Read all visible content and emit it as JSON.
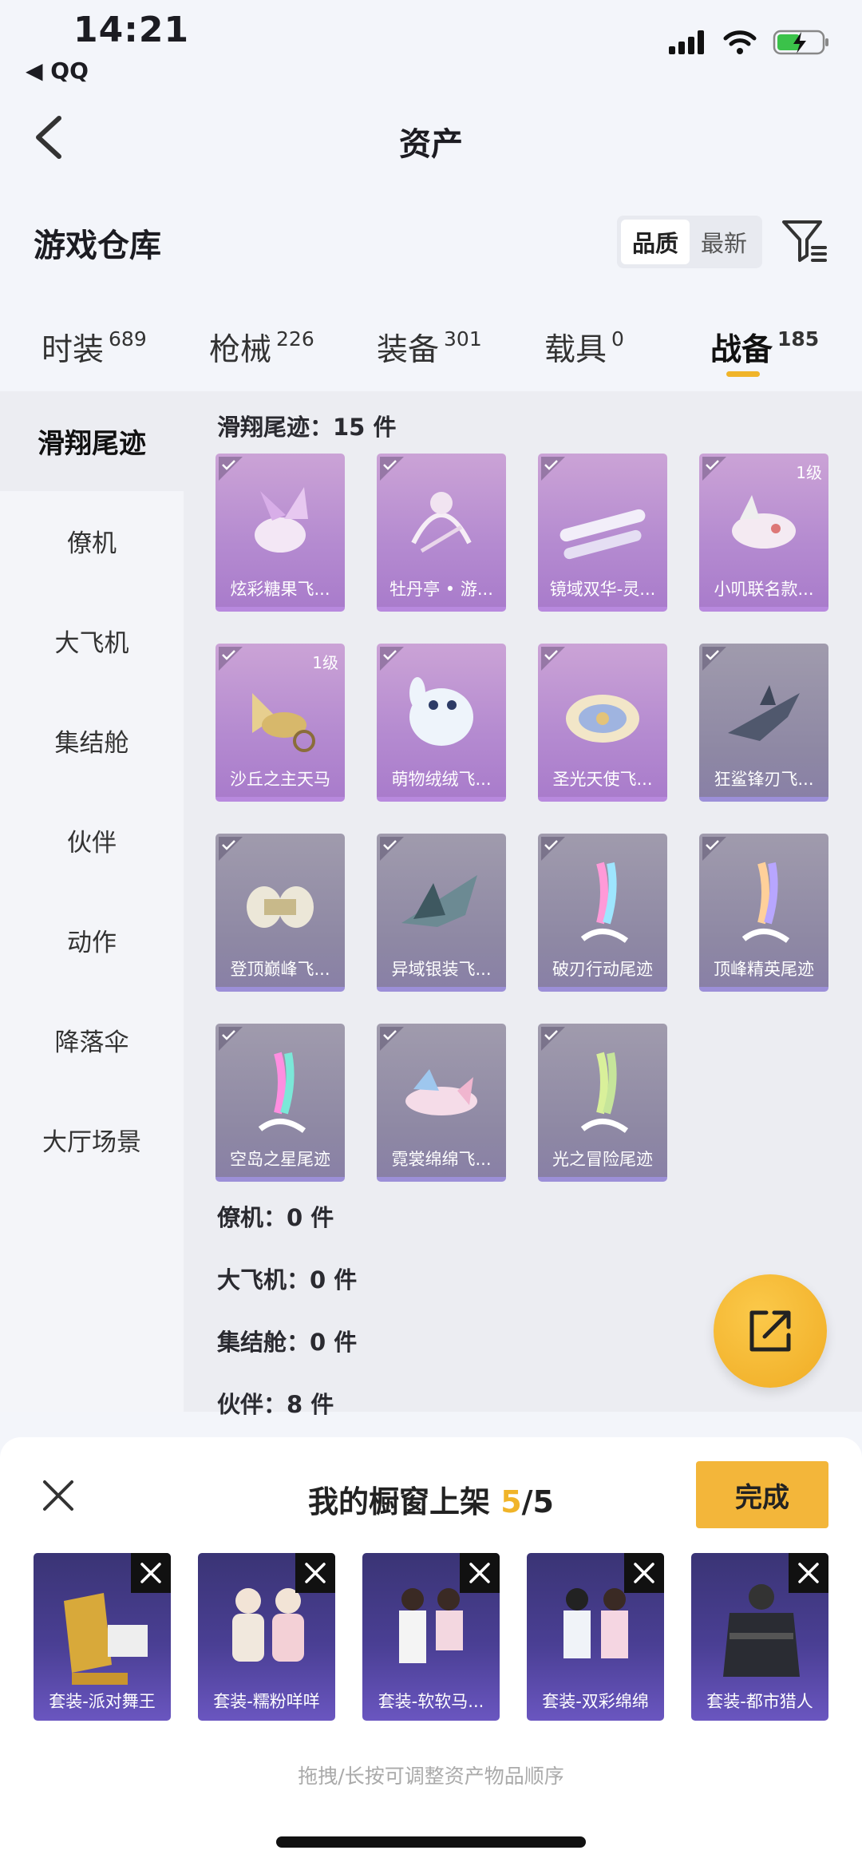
{
  "status_bar": {
    "time": "14:21",
    "back_app": "◀ QQ"
  },
  "nav": {
    "title": "资产"
  },
  "warehouse": {
    "title": "游戏仓库",
    "sort_options": [
      "品质",
      "最新"
    ],
    "active_sort": "品质"
  },
  "tabs": [
    {
      "label": "时装",
      "count": "689"
    },
    {
      "label": "枪械",
      "count": "226"
    },
    {
      "label": "装备",
      "count": "301"
    },
    {
      "label": "载具",
      "count": "0"
    },
    {
      "label": "战备",
      "count": "185"
    }
  ],
  "active_tab": "战备",
  "sidebar": [
    {
      "label": "滑翔尾迹"
    },
    {
      "label": "僚机"
    },
    {
      "label": "大飞机"
    },
    {
      "label": "集结舱"
    },
    {
      "label": "伙伴"
    },
    {
      "label": "动作"
    },
    {
      "label": "降落伞"
    },
    {
      "label": "大厅场景"
    }
  ],
  "sections": {
    "glide": "滑翔尾迹：15 件",
    "wingman": "僚机：0 件",
    "bigplane": "大飞机：0 件",
    "pod": "集结舱：0 件",
    "partner": "伙伴：8 件"
  },
  "items": [
    {
      "name": "炫彩糖果飞...",
      "level": "",
      "rarity": "purple"
    },
    {
      "name": "牡丹亭 • 游...",
      "level": "",
      "rarity": "purple"
    },
    {
      "name": "镜域双华-灵...",
      "level": "",
      "rarity": "purple"
    },
    {
      "name": "小叽联名款...",
      "level": "1级",
      "rarity": "purple"
    },
    {
      "name": "沙丘之主天马",
      "level": "1级",
      "rarity": "purple"
    },
    {
      "name": "萌物绒绒飞...",
      "level": "",
      "rarity": "purple"
    },
    {
      "name": "圣光天使飞...",
      "level": "",
      "rarity": "purple"
    },
    {
      "name": "狂鲨锋刃飞...",
      "level": "",
      "rarity": "gray"
    },
    {
      "name": "登顶巅峰飞...",
      "level": "",
      "rarity": "gray"
    },
    {
      "name": "异域银装飞...",
      "level": "",
      "rarity": "gray"
    },
    {
      "name": "破刃行动尾迹",
      "level": "",
      "rarity": "gray"
    },
    {
      "name": "顶峰精英尾迹",
      "level": "",
      "rarity": "gray"
    },
    {
      "name": "空岛之星尾迹",
      "level": "",
      "rarity": "gray"
    },
    {
      "name": "霓裳绵绵飞...",
      "level": "",
      "rarity": "gray"
    },
    {
      "name": "光之冒险尾迹",
      "level": "",
      "rarity": "gray"
    }
  ],
  "sheet": {
    "title_prefix": "我的橱窗上架 ",
    "count": "5",
    "total": "/5",
    "done_label": "完成",
    "hint": "拖拽/长按可调整资产物品顺序",
    "shelf": [
      {
        "name": "套装-派对舞王"
      },
      {
        "name": "套装-糯粉咩咩"
      },
      {
        "name": "套装-软软马..."
      },
      {
        "name": "套装-双彩绵绵"
      },
      {
        "name": "套装-都市猎人"
      }
    ]
  },
  "colors": {
    "accent": "#f0b429",
    "purple_card": "#b48ad0",
    "gray_card": "#8e88a4",
    "shelf_card": "#4a3f94"
  }
}
